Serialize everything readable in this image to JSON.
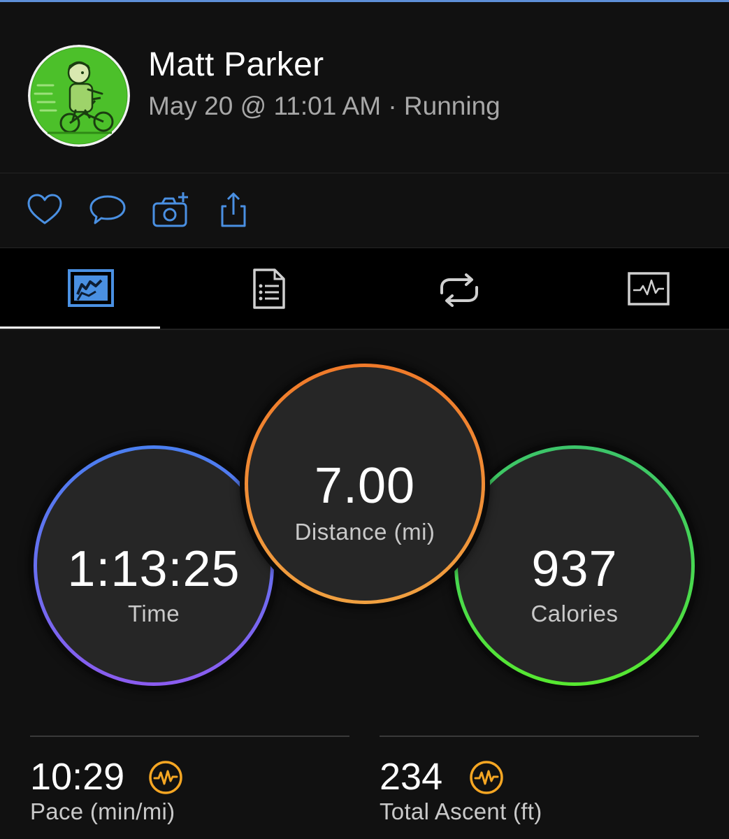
{
  "header": {
    "user_name": "Matt Parker",
    "activity_meta": "May 20 @ 11:01 AM · Running"
  },
  "actions": [
    "heart-icon",
    "comment-icon",
    "add-photo-icon",
    "share-icon"
  ],
  "tabs": [
    {
      "icon": "map-chart-icon",
      "selected": true
    },
    {
      "icon": "document-list-icon",
      "selected": false
    },
    {
      "icon": "laps-repeat-icon",
      "selected": false
    },
    {
      "icon": "graph-chart-icon",
      "selected": false
    }
  ],
  "rings": {
    "time": {
      "value": "1:13:25",
      "label": "Time"
    },
    "distance": {
      "value": "7.00",
      "label": "Distance (mi)"
    },
    "calories": {
      "value": "937",
      "label": "Calories"
    }
  },
  "metrics": {
    "pace": {
      "value": "10:29",
      "label": "Pace (min/mi)"
    },
    "ascent": {
      "value": "234",
      "label": "Total Ascent (ft)"
    }
  },
  "colors": {
    "accent_blue": "#4a90e2",
    "time_ring": [
      "#4a7ff0",
      "#8b5cf0"
    ],
    "distance_ring": [
      "#f07a2a",
      "#f0a040"
    ],
    "calories_ring": [
      "#3cd46a",
      "#57e830"
    ],
    "metric_icon": "#f5a623"
  }
}
